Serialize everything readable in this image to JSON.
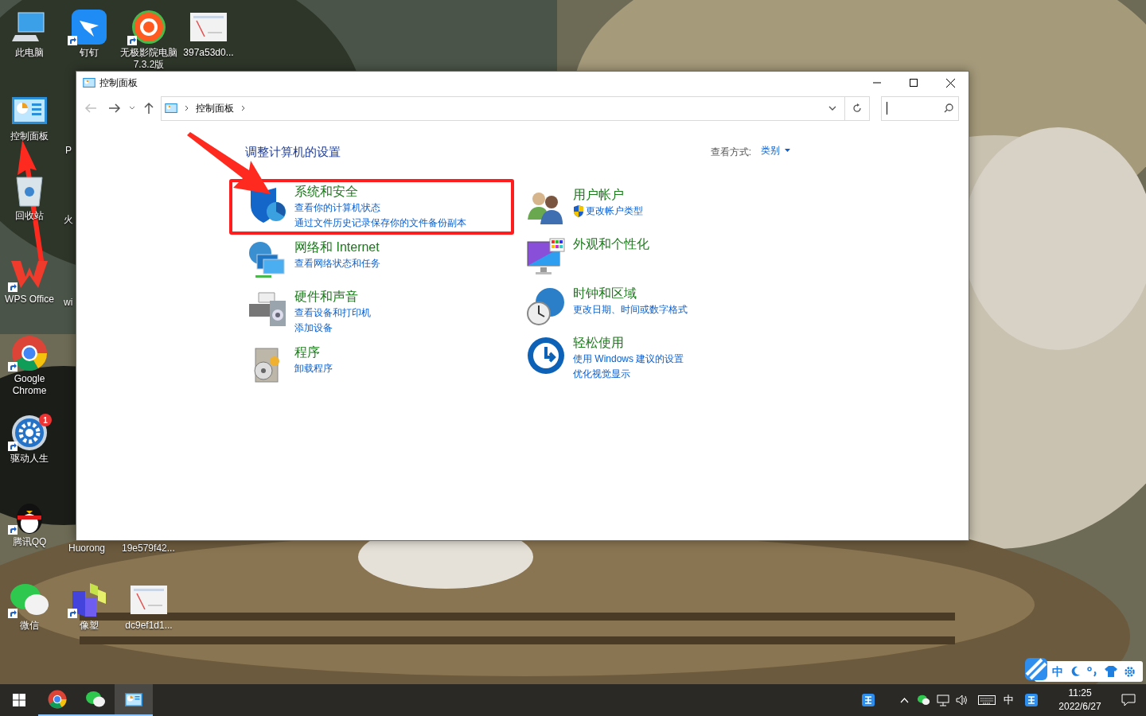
{
  "desktop": {
    "icons": [
      {
        "label": "此电脑",
        "kind": "computer",
        "shortcut": false
      },
      {
        "label": "钉钉",
        "kind": "dingtalk",
        "shortcut": true
      },
      {
        "label": "无极影院电脑7.3.2版",
        "kind": "media",
        "shortcut": true
      },
      {
        "label": "397a53d0...",
        "kind": "thumbnail",
        "shortcut": false
      },
      {
        "label": "控制面板",
        "kind": "control-panel",
        "shortcut": false
      },
      {
        "label": "P",
        "kind": "covered"
      },
      {
        "label": "回收站",
        "kind": "recycle-bin",
        "shortcut": false
      },
      {
        "label": "火",
        "kind": "covered"
      },
      {
        "label": "WPS Office",
        "kind": "wps",
        "shortcut": true
      },
      {
        "label": "wi",
        "kind": "covered"
      },
      {
        "label": "Google Chrome",
        "kind": "chrome",
        "shortcut": true
      },
      {
        "label": "驱动人生",
        "kind": "gear",
        "shortcut": true,
        "badge": "1"
      },
      {
        "label": "腾讯QQ",
        "kind": "penguin",
        "shortcut": true
      },
      {
        "label": "Huorong",
        "kind": "covered"
      },
      {
        "label": "19e579f42...",
        "kind": "covered"
      },
      {
        "label": "微信",
        "kind": "wechat",
        "shortcut": true
      },
      {
        "label": "像塑",
        "kind": "cubes",
        "shortcut": true
      },
      {
        "label": "dc9ef1d1...",
        "kind": "thumbnail",
        "shortcut": false
      }
    ]
  },
  "window": {
    "title": "控制面板",
    "address": "控制面板",
    "heading": "调整计算机的设置",
    "view_by": {
      "label": "查看方式:",
      "value": "类别"
    },
    "left_categories": [
      {
        "title": "系统和安全",
        "highlighted": true,
        "links": [
          {
            "text": "查看你的计算机状态"
          },
          {
            "text": "通过文件历史记录保存你的文件备份副本"
          }
        ]
      },
      {
        "title": "网络和 Internet",
        "highlighted": false,
        "links": [
          {
            "text": "查看网络状态和任务"
          }
        ]
      },
      {
        "title": "硬件和声音",
        "highlighted": false,
        "links": [
          {
            "text": "查看设备和打印机"
          },
          {
            "text": "添加设备"
          }
        ]
      },
      {
        "title": "程序",
        "highlighted": false,
        "links": [
          {
            "text": "卸载程序"
          }
        ]
      }
    ],
    "right_categories": [
      {
        "title": "用户帐户",
        "highlighted": false,
        "links": [
          {
            "text": "更改帐户类型",
            "shield": true
          }
        ]
      },
      {
        "title": "外观和个性化",
        "highlighted": false
      },
      {
        "title": "时钟和区域",
        "highlighted": false,
        "links": [
          {
            "text": "更改日期、时间或数字格式"
          }
        ]
      },
      {
        "title": "轻松使用",
        "highlighted": false,
        "links": [
          {
            "text": "使用 Windows 建议的设置"
          },
          {
            "text": "优化视觉显示"
          }
        ]
      }
    ]
  },
  "ime_toolbar": {
    "mode": "中"
  },
  "taskbar": {
    "apps": [
      {
        "kind": "chrome",
        "active": false
      },
      {
        "kind": "wechat",
        "active": false
      },
      {
        "kind": "control-panel",
        "active": true
      }
    ],
    "tray": {
      "input_mode": "中",
      "time": "11:25",
      "date": "2022/6/27"
    }
  }
}
